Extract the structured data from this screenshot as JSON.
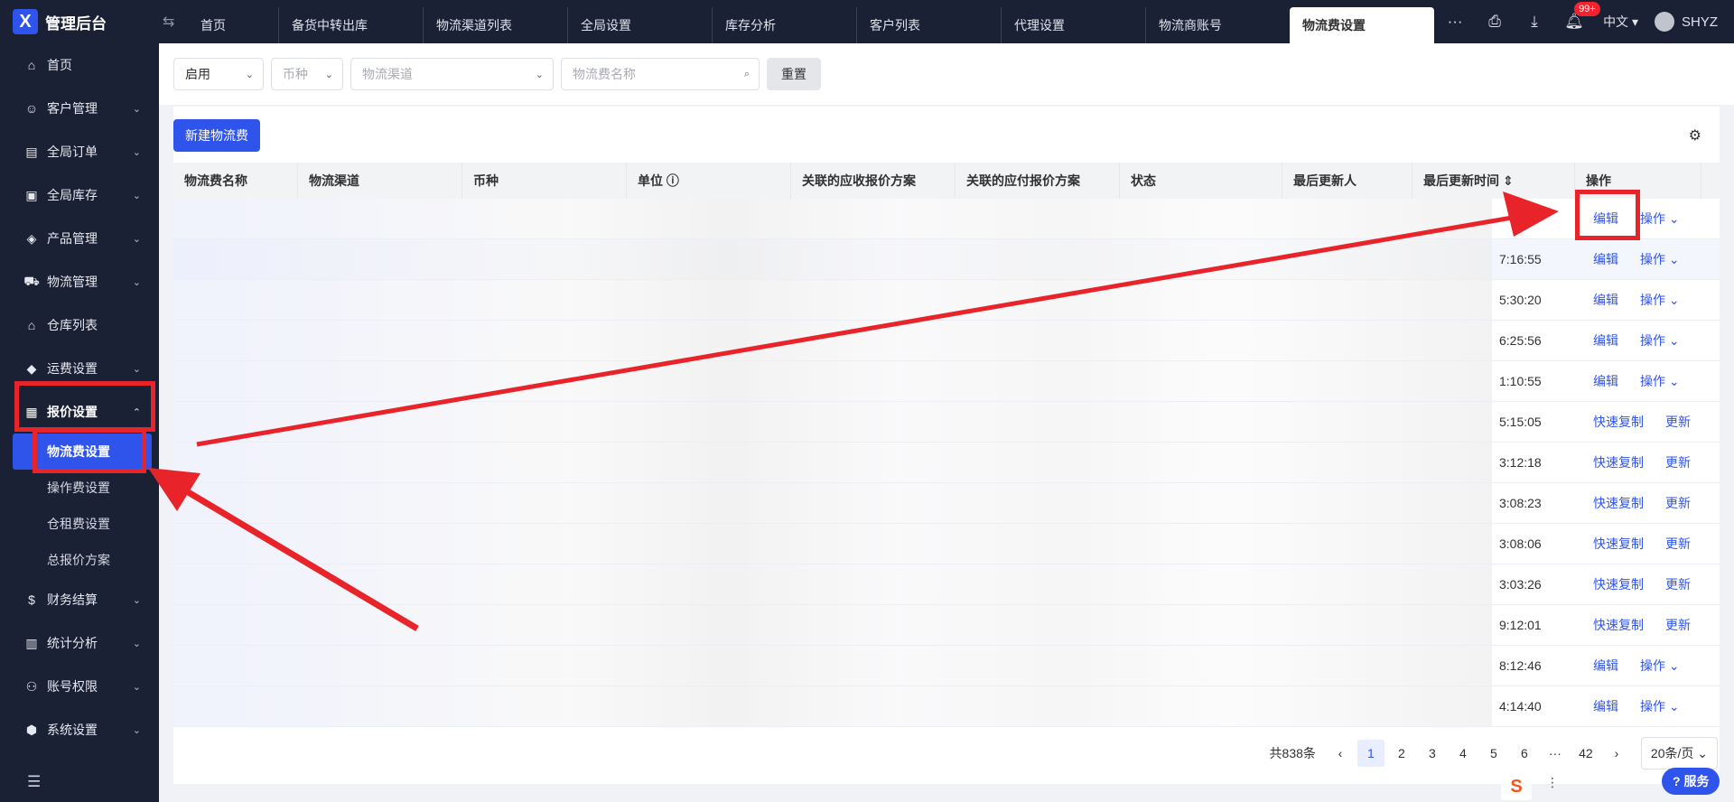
{
  "app": {
    "title": "管理后台",
    "logo_glyph": "X",
    "collapse_icon": "⇆"
  },
  "tabs": [
    "首页",
    "备货中转出库",
    "物流渠道列表",
    "全局设置",
    "库存分析",
    "客户列表",
    "代理设置",
    "物流商账号",
    "物流费设置"
  ],
  "topbar": {
    "more": "···",
    "notification_badge": "99+",
    "language": "中文",
    "user": "SHYZ"
  },
  "sidebar": {
    "items": [
      {
        "label": "首页",
        "icon": "⌂"
      },
      {
        "label": "客户管理",
        "icon": "☺"
      },
      {
        "label": "全局订单",
        "icon": "▤"
      },
      {
        "label": "全局库存",
        "icon": "▣"
      },
      {
        "label": "产品管理",
        "icon": "◈"
      },
      {
        "label": "物流管理",
        "icon": "⛟"
      },
      {
        "label": "仓库列表",
        "icon": "⌂"
      },
      {
        "label": "运费设置",
        "icon": "◆"
      },
      {
        "label": "报价设置",
        "icon": "▦"
      }
    ],
    "sub_items": [
      "物流费设置",
      "操作费设置",
      "仓租费设置",
      "总报价方案"
    ],
    "items_after": [
      {
        "label": "财务结算",
        "icon": "$"
      },
      {
        "label": "统计分析",
        "icon": "▥"
      },
      {
        "label": "账号权限",
        "icon": "⚇"
      },
      {
        "label": "系统设置",
        "icon": "⬢"
      }
    ],
    "bottom_icon": "☰"
  },
  "filters": {
    "status_value": "启用",
    "currency_placeholder": "币种",
    "channel_placeholder": "物流渠道",
    "name_placeholder": "物流费名称",
    "reset_label": "重置"
  },
  "toolbar": {
    "new_label": "新建物流费"
  },
  "table": {
    "columns": [
      "物流费名称",
      "物流渠道",
      "币种",
      "单位 ⓘ",
      "关联的应收报价方案",
      "关联的应付报价方案",
      "状态",
      "最后更新人",
      "最后更新时间 ⇕",
      "操作"
    ],
    "rows": [
      {
        "time": "",
        "action": "编辑",
        "action2": "操作 ⌄"
      },
      {
        "time": "7:16:55",
        "action": "编辑",
        "action2": "操作 ⌄"
      },
      {
        "time": "5:30:20",
        "action": "编辑",
        "action2": "操作 ⌄"
      },
      {
        "time": "6:25:56",
        "action": "编辑",
        "action2": "操作 ⌄"
      },
      {
        "time": "1:10:55",
        "action": "编辑",
        "action2": "操作 ⌄"
      },
      {
        "time": "5:15:05",
        "action": "快速复制",
        "action2": "更新"
      },
      {
        "time": "3:12:18",
        "action": "快速复制",
        "action2": "更新"
      },
      {
        "time": "3:08:23",
        "action": "快速复制",
        "action2": "更新"
      },
      {
        "time": "3:08:06",
        "action": "快速复制",
        "action2": "更新"
      },
      {
        "time": "3:03:26",
        "action": "快速复制",
        "action2": "更新"
      },
      {
        "time": "9:12:01",
        "action": "快速复制",
        "action2": "更新"
      },
      {
        "time": "8:12:46",
        "action": "编辑",
        "action2": "操作 ⌄"
      },
      {
        "time": "4:14:40",
        "action": "编辑",
        "action2": "操作 ⌄"
      }
    ]
  },
  "pagination": {
    "total": "共838条",
    "pages": [
      "1",
      "2",
      "3",
      "4",
      "5",
      "6",
      "···",
      "42"
    ],
    "page_size": "20条/页"
  },
  "service_button": "服务",
  "accent": "#2f54eb",
  "annotation_color": "#e8242a"
}
